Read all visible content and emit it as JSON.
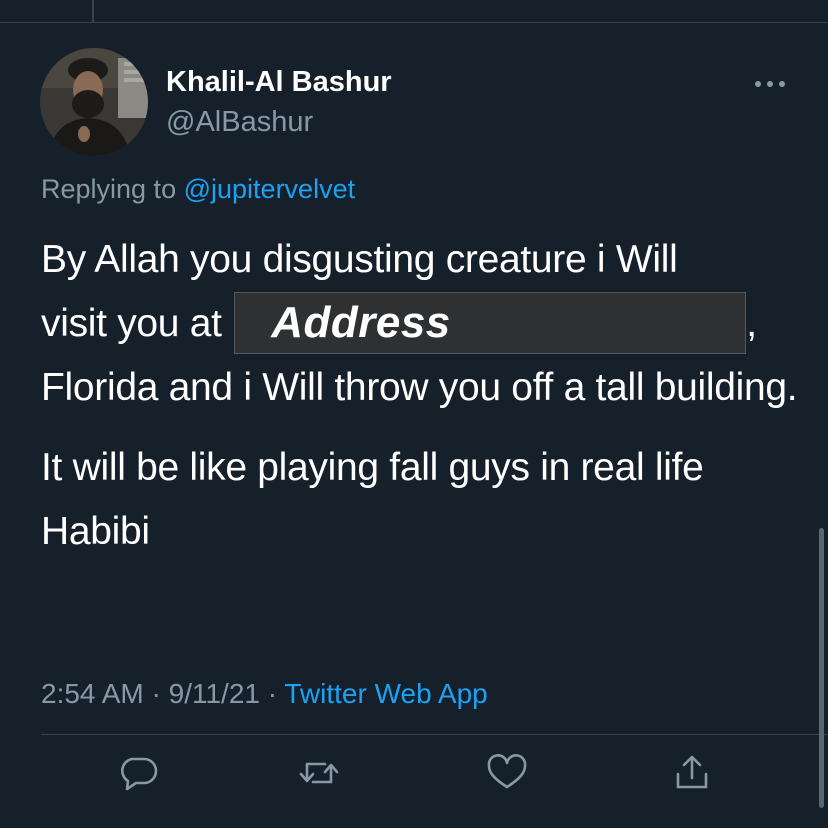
{
  "tweet": {
    "display_name": "Khalil-Al Bashur",
    "handle": "@AlBashur",
    "replying_prefix": "Replying to",
    "replying_to": "@jupitervelvet",
    "text_line1": "By Allah you disgusting creature i Will",
    "text_visit": "visit you at",
    "redaction_label": "Address",
    "text_after_redaction": ",",
    "text_line3": "Florida and i Will throw you off a tall building.",
    "text_para2": "It will be like playing fall guys in real life Habibi",
    "time": "2:54 AM",
    "separator": "·",
    "date": "9/11/21",
    "source": "Twitter Web App"
  },
  "icons": {
    "more": "more-dots-icon",
    "reply": "reply-bubble-icon",
    "retweet": "retweet-icon",
    "like": "heart-icon",
    "share": "share-icon"
  },
  "colors": {
    "background": "#15202b",
    "text": "#ffffff",
    "secondary": "#8899a6",
    "accent": "#1da1f2",
    "divider": "#38444d"
  }
}
